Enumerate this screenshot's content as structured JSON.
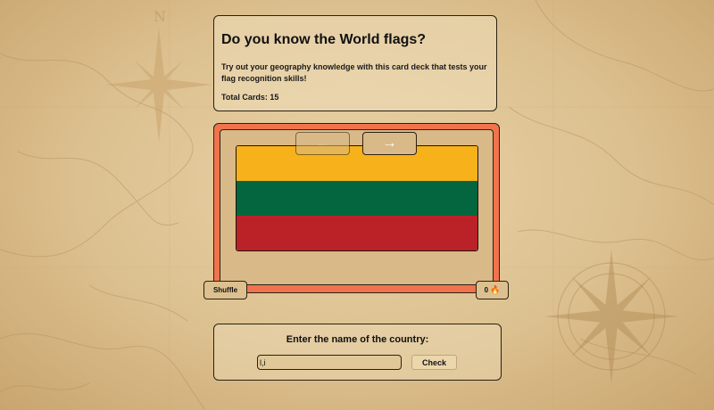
{
  "header": {
    "title": "Do you know the World flags?",
    "description": "Try out your geography knowledge with this card deck that tests your flag recognition skills!",
    "total_cards": "Total Cards: 15"
  },
  "flag_card": {
    "stripes": [
      "#f7b11a",
      "#03663f",
      "#bb2228"
    ],
    "prev_glyph": "←",
    "next_glyph": "→"
  },
  "controls": {
    "shuffle_label": "Shuffle",
    "streak_count": "0",
    "streak_icon": "🔥"
  },
  "answer": {
    "prompt": "Enter the name of the country:",
    "input_value": "l,i",
    "check_label": "Check"
  },
  "colors": {
    "frame_accent": "#f0734d",
    "panel": "#d9b987",
    "border": "#2b2113"
  }
}
